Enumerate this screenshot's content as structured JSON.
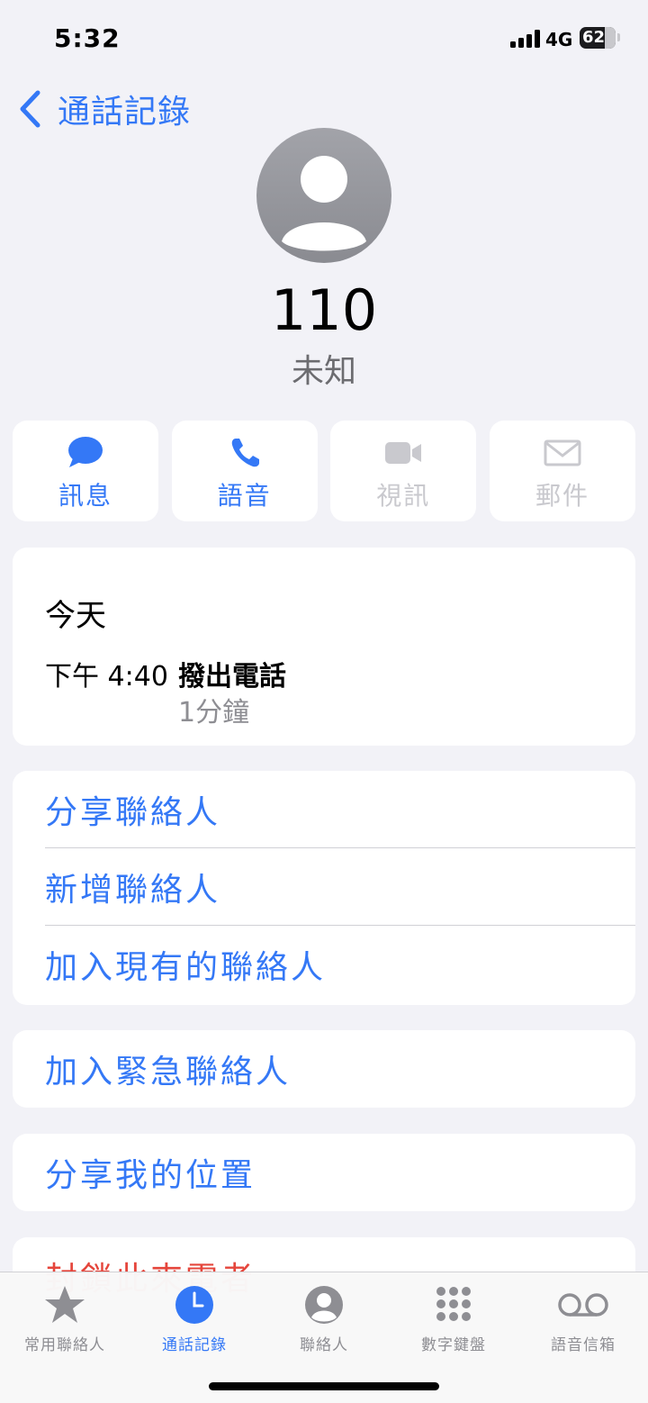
{
  "status": {
    "time": "5:32",
    "network": "4G",
    "battery": "62"
  },
  "nav": {
    "back_label": "通話記錄"
  },
  "contact": {
    "name": "110",
    "subtitle": "未知"
  },
  "actions": [
    {
      "label": "訊息",
      "icon": "message-bubble-icon",
      "enabled": true
    },
    {
      "label": "語音",
      "icon": "phone-icon",
      "enabled": true
    },
    {
      "label": "視訊",
      "icon": "video-camera-icon",
      "enabled": false
    },
    {
      "label": "郵件",
      "icon": "envelope-icon",
      "enabled": false
    }
  ],
  "history": {
    "day": "今天",
    "time": "下午 4:40",
    "type": "撥出電話",
    "duration": "1分鐘"
  },
  "options": {
    "share_contact": "分享聯絡人",
    "new_contact": "新增聯絡人",
    "add_existing": "加入現有的聯絡人",
    "add_emergency": "加入緊急聯絡人",
    "share_location": "分享我的位置",
    "block_caller": "封鎖此來電者"
  },
  "tabs": [
    {
      "label": "常用聯絡人",
      "icon": "star-icon",
      "active": false
    },
    {
      "label": "通話記錄",
      "icon": "clock-icon",
      "active": true
    },
    {
      "label": "聯絡人",
      "icon": "person-circle-icon",
      "active": false
    },
    {
      "label": "數字鍵盤",
      "icon": "keypad-icon",
      "active": false
    },
    {
      "label": "語音信箱",
      "icon": "voicemail-icon",
      "active": false
    }
  ],
  "colors": {
    "accent": "#3478f6",
    "destructive": "#e5453b",
    "background": "#f2f2f7"
  }
}
